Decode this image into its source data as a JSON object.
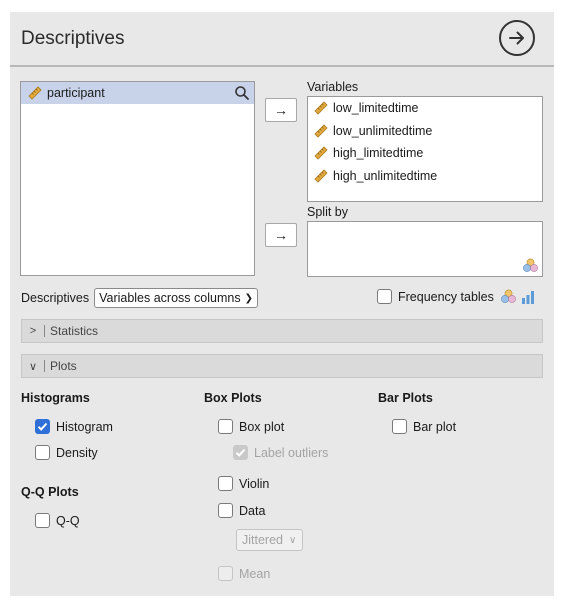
{
  "header": {
    "title": "Descriptives",
    "go_icon": "arrow-right-circle-icon"
  },
  "source_list": {
    "items": [
      {
        "label": "participant",
        "icon": "ruler-icon",
        "selected": true
      }
    ]
  },
  "variables_box": {
    "label": "Variables",
    "items": [
      {
        "label": "low_limitedtime",
        "icon": "ruler-icon"
      },
      {
        "label": "low_unlimitedtime",
        "icon": "ruler-icon"
      },
      {
        "label": "high_limitedtime",
        "icon": "ruler-icon"
      },
      {
        "label": "high_unlimitedtime",
        "icon": "ruler-icon"
      }
    ]
  },
  "split_box": {
    "label": "Split by",
    "items": []
  },
  "move_button_glyph": "→",
  "descriptives_row": {
    "label": "Descriptives",
    "selected_option": "Variables across columns"
  },
  "frequency_tables": {
    "label": "Frequency tables",
    "checked": false
  },
  "sections": {
    "statistics": "Statistics",
    "plots": "Plots"
  },
  "plots": {
    "histograms": {
      "heading": "Histograms",
      "histogram": "Histogram",
      "density": "Density"
    },
    "qq": {
      "heading": "Q-Q Plots",
      "qq": "Q-Q"
    },
    "box_plots": {
      "heading": "Box Plots",
      "box_plot": "Box plot",
      "label_outliers": "Label outliers",
      "violin": "Violin",
      "data": "Data",
      "jitter_option": "Jittered",
      "mean": "Mean"
    },
    "bar_plots": {
      "heading": "Bar Plots",
      "bar_plot": "Bar plot"
    }
  },
  "colors": {
    "accent": "#2e6fd8",
    "selection": "#c8d3ea",
    "ruler": "#e0a93a"
  }
}
